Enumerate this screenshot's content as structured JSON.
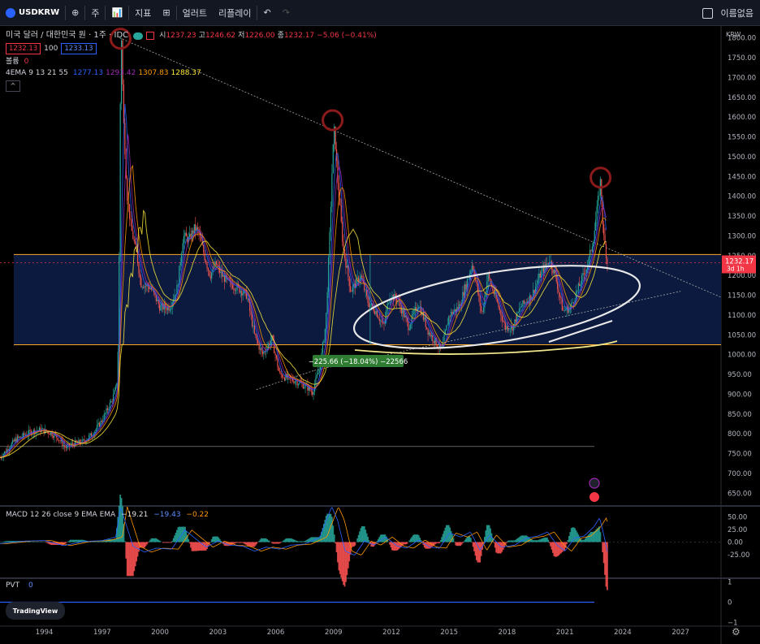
{
  "toolbar": {
    "symbol": "USDKRW",
    "add_symbol": "⊕",
    "interval": "주",
    "chart_type": "📊",
    "indicators": "지표",
    "templates": "⊞",
    "alert": "얼러트",
    "replay": "리플레이",
    "undo": "↶",
    "redo": "↷",
    "save": "이름없음"
  },
  "legend": {
    "title": "미국 달러 / 대한민국 원 · 1주 · IDC",
    "open_label": "시",
    "open": "1237.23",
    "high_label": "고",
    "high": "1246.62",
    "low_label": "저",
    "low": "1226.00",
    "close_label": "종",
    "close": "1232.17",
    "change": "−5.06 (−0.41%)",
    "bid": "1232.13",
    "spread": "100",
    "ask": "1233.13",
    "volume_label": "볼륨",
    "volume": "0",
    "ema_label": "4EMA 9 13 21 55",
    "ema_values": [
      "1277.13",
      "1293.42",
      "1307.83",
      "1288.37"
    ],
    "collapse": "^"
  },
  "macd_legend": {
    "label": "MACD 12 26 close 9 EMA EMA",
    "values": [
      "−19.21",
      "−19.43",
      "−0.22"
    ]
  },
  "pvt_legend": {
    "label": "PVT",
    "value": "0"
  },
  "branding": {
    "logo_text": "TradingView"
  },
  "colors": {
    "background": "#000000",
    "up": "#26a69a",
    "down": "#ef5350",
    "ema1": "#2962ff",
    "ema2": "#9c27b0",
    "ema3": "#ff9800",
    "ema4": "#ffeb3b",
    "band_fill": "#0b1a3e",
    "band_line": "#ffa726",
    "price_label": "#f23645",
    "measure_label": "#2e7d32",
    "annotation_ring": "#8b1a1a"
  },
  "chart_data": {
    "type": "candlestick",
    "currency_label": "KRW",
    "y_ticks": [
      650,
      700,
      750,
      800,
      850,
      900,
      950,
      1000,
      1050,
      1100,
      1150,
      1200,
      1250,
      1300,
      1350,
      1400,
      1450,
      1500,
      1550,
      1600,
      1650,
      1700,
      1750,
      1800
    ],
    "ylim": [
      620,
      1830
    ],
    "x_ticks": [
      1994,
      1997,
      2000,
      2003,
      2006,
      2009,
      2012,
      2015,
      2018,
      2021,
      2024,
      2027
    ],
    "xlim": [
      1991.7,
      2029.1
    ],
    "last_price": "1232.17",
    "last_price_time": "3d 1h",
    "price_series": [
      [
        1991.7,
        740
      ],
      [
        1992.5,
        785
      ],
      [
        1993.3,
        805
      ],
      [
        1993.8,
        810
      ],
      [
        1994.3,
        803
      ],
      [
        1994.7,
        790
      ],
      [
        1995.1,
        765
      ],
      [
        1995.5,
        775
      ],
      [
        1996.0,
        780
      ],
      [
        1996.5,
        800
      ],
      [
        1997.0,
        835
      ],
      [
        1997.5,
        885
      ],
      [
        1997.75,
        920
      ],
      [
        1997.85,
        1050
      ],
      [
        1997.95,
        1700
      ],
      [
        1998.0,
        1800
      ],
      [
        1998.1,
        1600
      ],
      [
        1998.3,
        1400
      ],
      [
        1998.5,
        1320
      ],
      [
        1998.8,
        1250
      ],
      [
        1999.0,
        1180
      ],
      [
        1999.5,
        1170
      ],
      [
        2000.0,
        1120
      ],
      [
        2000.5,
        1120
      ],
      [
        2000.9,
        1170
      ],
      [
        2001.2,
        1300
      ],
      [
        2001.5,
        1290
      ],
      [
        2001.8,
        1320
      ],
      [
        2002.0,
        1310
      ],
      [
        2002.3,
        1250
      ],
      [
        2002.6,
        1200
      ],
      [
        2002.9,
        1230
      ],
      [
        2003.2,
        1200
      ],
      [
        2003.6,
        1180
      ],
      [
        2004.0,
        1170
      ],
      [
        2004.5,
        1150
      ],
      [
        2004.9,
        1050
      ],
      [
        2005.3,
        1000
      ],
      [
        2005.8,
        1040
      ],
      [
        2006.2,
        950
      ],
      [
        2006.7,
        940
      ],
      [
        2007.2,
        930
      ],
      [
        2007.7,
        915
      ],
      [
        2007.9,
        905
      ],
      [
        2008.3,
        970
      ],
      [
        2008.6,
        1080
      ],
      [
        2008.8,
        1300
      ],
      [
        2008.95,
        1500
      ],
      [
        2009.05,
        1570
      ],
      [
        2009.2,
        1450
      ],
      [
        2009.5,
        1270
      ],
      [
        2009.9,
        1160
      ],
      [
        2010.4,
        1200
      ],
      [
        2010.8,
        1130
      ],
      [
        2011.2,
        1110
      ],
      [
        2011.6,
        1070
      ],
      [
        2011.9,
        1150
      ],
      [
        2012.3,
        1140
      ],
      [
        2012.9,
        1070
      ],
      [
        2013.4,
        1130
      ],
      [
        2013.9,
        1060
      ],
      [
        2014.3,
        1030
      ],
      [
        2014.6,
        1010
      ],
      [
        2015.0,
        1100
      ],
      [
        2015.5,
        1120
      ],
      [
        2015.9,
        1180
      ],
      [
        2016.2,
        1230
      ],
      [
        2016.7,
        1100
      ],
      [
        2017.0,
        1200
      ],
      [
        2017.5,
        1130
      ],
      [
        2017.9,
        1070
      ],
      [
        2018.3,
        1070
      ],
      [
        2018.7,
        1120
      ],
      [
        2019.3,
        1150
      ],
      [
        2019.7,
        1200
      ],
      [
        2020.2,
        1240
      ],
      [
        2020.5,
        1200
      ],
      [
        2020.9,
        1110
      ],
      [
        2021.3,
        1120
      ],
      [
        2021.8,
        1180
      ],
      [
        2022.2,
        1230
      ],
      [
        2022.5,
        1300
      ],
      [
        2022.75,
        1400
      ],
      [
        2022.85,
        1440
      ],
      [
        2023.0,
        1300
      ],
      [
        2023.1,
        1270
      ],
      [
        2023.2,
        1232
      ]
    ],
    "support_band": [
      1025,
      1253
    ],
    "measure_label": "−225.66 (−18.04%) −22566",
    "macd": {
      "ylim": [
        -70,
        70
      ],
      "ticks": [
        50,
        25,
        0,
        -25
      ],
      "series": [
        [
          1991.7,
          -3
        ],
        [
          1993,
          2
        ],
        [
          1994,
          3
        ],
        [
          1995,
          -7
        ],
        [
          1996,
          1
        ],
        [
          1997,
          3
        ],
        [
          1997.7,
          10
        ],
        [
          1997.95,
          70
        ],
        [
          1998.2,
          40
        ],
        [
          1998.6,
          -8
        ],
        [
          1999.2,
          -20
        ],
        [
          1999.8,
          -12
        ],
        [
          2000.6,
          -14
        ],
        [
          2001.3,
          24
        ],
        [
          2001.8,
          8
        ],
        [
          2002.4,
          -10
        ],
        [
          2003.0,
          2
        ],
        [
          2003.6,
          -6
        ],
        [
          2004.3,
          -8
        ],
        [
          2004.9,
          -18
        ],
        [
          2005.5,
          -10
        ],
        [
          2006.2,
          -14
        ],
        [
          2006.8,
          -6
        ],
        [
          2007.5,
          -4
        ],
        [
          2008.3,
          10
        ],
        [
          2008.9,
          70
        ],
        [
          2009.2,
          45
        ],
        [
          2009.6,
          -18
        ],
        [
          2010.1,
          -26
        ],
        [
          2010.6,
          2
        ],
        [
          2011.1,
          -6
        ],
        [
          2011.7,
          10
        ],
        [
          2012.3,
          -8
        ],
        [
          2012.8,
          -12
        ],
        [
          2013.4,
          4
        ],
        [
          2014.0,
          -10
        ],
        [
          2014.5,
          -12
        ],
        [
          2015.0,
          18
        ],
        [
          2015.6,
          10
        ],
        [
          2016.1,
          20
        ],
        [
          2016.6,
          -16
        ],
        [
          2017.1,
          14
        ],
        [
          2017.7,
          -10
        ],
        [
          2018.4,
          -6
        ],
        [
          2019.0,
          8
        ],
        [
          2019.6,
          12
        ],
        [
          2020.1,
          20
        ],
        [
          2020.6,
          -6
        ],
        [
          2021.0,
          -18
        ],
        [
          2021.5,
          8
        ],
        [
          2022.0,
          12
        ],
        [
          2022.5,
          30
        ],
        [
          2022.8,
          48
        ],
        [
          2023.0,
          18
        ],
        [
          2023.2,
          -19
        ]
      ]
    },
    "pvt": {
      "ticks": [
        1,
        0,
        -1
      ],
      "value": 0
    }
  }
}
